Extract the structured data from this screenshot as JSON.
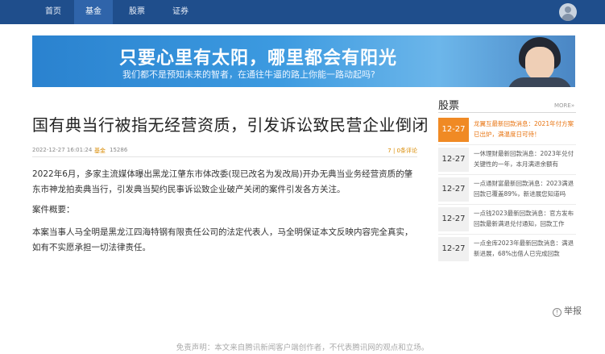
{
  "nav": {
    "items": [
      "首页",
      "基金",
      "股票",
      "证券"
    ]
  },
  "banner": {
    "title": "只要心里有太阳，哪里都会有阳光",
    "subtitle": "我们都不是预知未来的智者，在通往牛逼的路上你能一路动起吗?"
  },
  "article": {
    "headline": "国有典当行被指无经营资质，引发诉讼致民营企业倒闭",
    "date": "2022-12-27 16:01:24",
    "category": "基金",
    "views": "15286",
    "comments": "7 | 0条评论",
    "paragraphs": [
      "2022年6月，多家主流媒体曝出黑龙江肇东市体改委(现已改名为发改局)开办无典当业务经营资质的肇东市神龙拍卖典当行，引发典当契约民事诉讼致企业破产关闭的案件引发各方关注。",
      "案件概要：",
      "本案当事人马全明是黑龙江四海特钢有限责任公司的法定代表人，马全明保证本文反映内容完全真实，如有不实愿承担一切法律责任。"
    ]
  },
  "sidebar": {
    "title": "股票",
    "more": "MORE»",
    "items": [
      {
        "date": "12-27",
        "text": "龙翼互最新回款消息：2021年付方案已出炉，满温度日可待！"
      },
      {
        "date": "12-27",
        "text": "一休理财最新回款消息：2023年兑付关键性的一年，本月满退余额有"
      },
      {
        "date": "12-27",
        "text": "一点通财富最新回款消息：2023满退回款已覆盖89%，新进展您知道吗"
      },
      {
        "date": "12-27",
        "text": "一点钱2023最新回款消息：官方发布回款最新满退兑付通知，回款工作"
      },
      {
        "date": "12-27",
        "text": "一点金库2023年最新回款消息：满退新进展，68%出借人已完成回款"
      }
    ]
  },
  "footer": {
    "report_icon": "!",
    "report": "举报",
    "disclaimer": "免责声明：本文来自腾讯新闻客户端创作者，不代表腾讯网的观点和立场。"
  }
}
